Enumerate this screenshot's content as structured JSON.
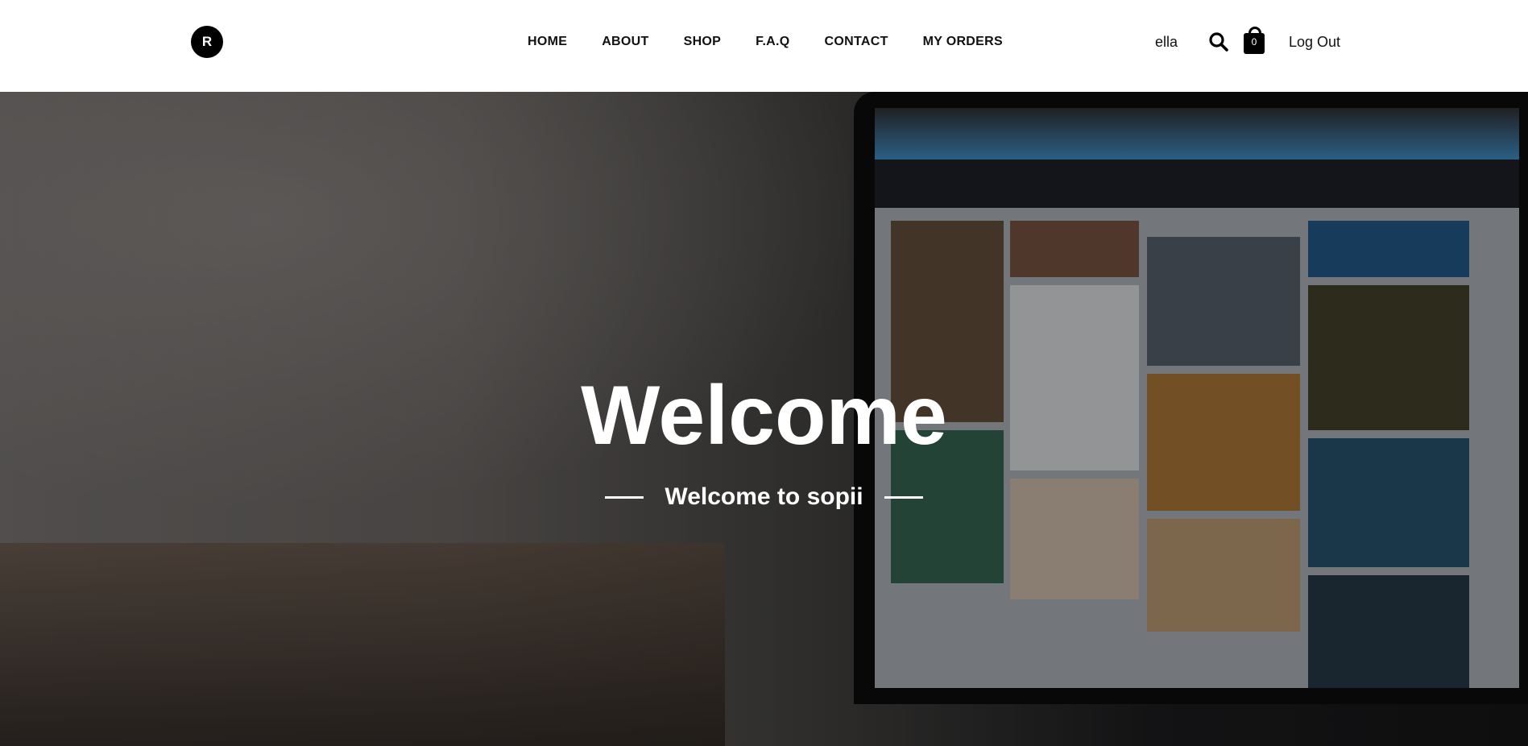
{
  "header": {
    "logo_letter": "R",
    "nav": [
      {
        "label": "HOME"
      },
      {
        "label": "ABOUT"
      },
      {
        "label": "SHOP"
      },
      {
        "label": "F.A.Q"
      },
      {
        "label": "CONTACT"
      },
      {
        "label": "MY ORDERS"
      }
    ],
    "username": "ella",
    "cart_count": "0",
    "logout_label": "Log Out"
  },
  "hero": {
    "title": "Welcome",
    "subtitle": "Welcome to sopii"
  },
  "colors": {
    "header_bg": "#ffffff",
    "nav_text": "#111111",
    "hero_text": "#ffffff",
    "logo_bg": "#000000"
  },
  "icons": [
    "search-icon",
    "shopping-bag-icon"
  ]
}
